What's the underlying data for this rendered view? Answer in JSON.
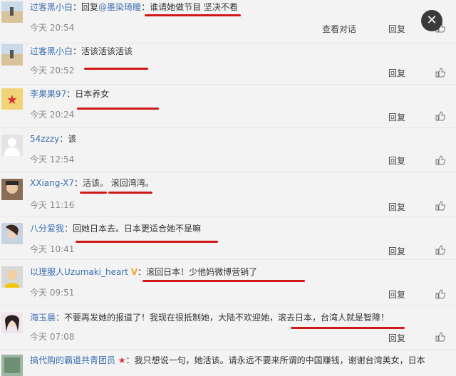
{
  "actions": {
    "reply_label": "回复",
    "view_conversation_label": "查看对话",
    "close_symbol": "✕"
  },
  "comments": [
    {
      "user": "过客黑小白",
      "reply_prefix": "回复",
      "mention": "@墨染琦瞳",
      "text": "谁请她做节目 坚决不看",
      "time": "今天 20:54"
    },
    {
      "user": "过客黑小白",
      "text": "活该活该活该",
      "time": "今天 20:52"
    },
    {
      "user": "李果果97",
      "text": "日本养女",
      "time": "今天 20:24"
    },
    {
      "user": "54zzzy",
      "text": "该",
      "time": "今天 12:54"
    },
    {
      "user": "XXiang-X7",
      "text": "活该。 滚回湾湾。",
      "time": "今天 11:16"
    },
    {
      "user": "八分爱我",
      "text": "回她日本去。日本更适合她不是嘛",
      "time": "今天 10:41"
    },
    {
      "user": "以理服人Uzumaki_heart",
      "badge": "V",
      "text": "滚回日本！少他妈微博营销了",
      "time": "今天 09:51"
    },
    {
      "user": "海玉晨",
      "text": "不要再发她的报道了！我现在很抵制她，大陆不欢迎她，滚去日本，台湾人就是智障！",
      "time": "今天 07:08"
    },
    {
      "user": "搞代购的霸道共青团员",
      "badge": "★",
      "text": "我只想说一句，她活该。请永远不要来所谓的中国赚钱，谢谢台湾美女，日本"
    }
  ]
}
